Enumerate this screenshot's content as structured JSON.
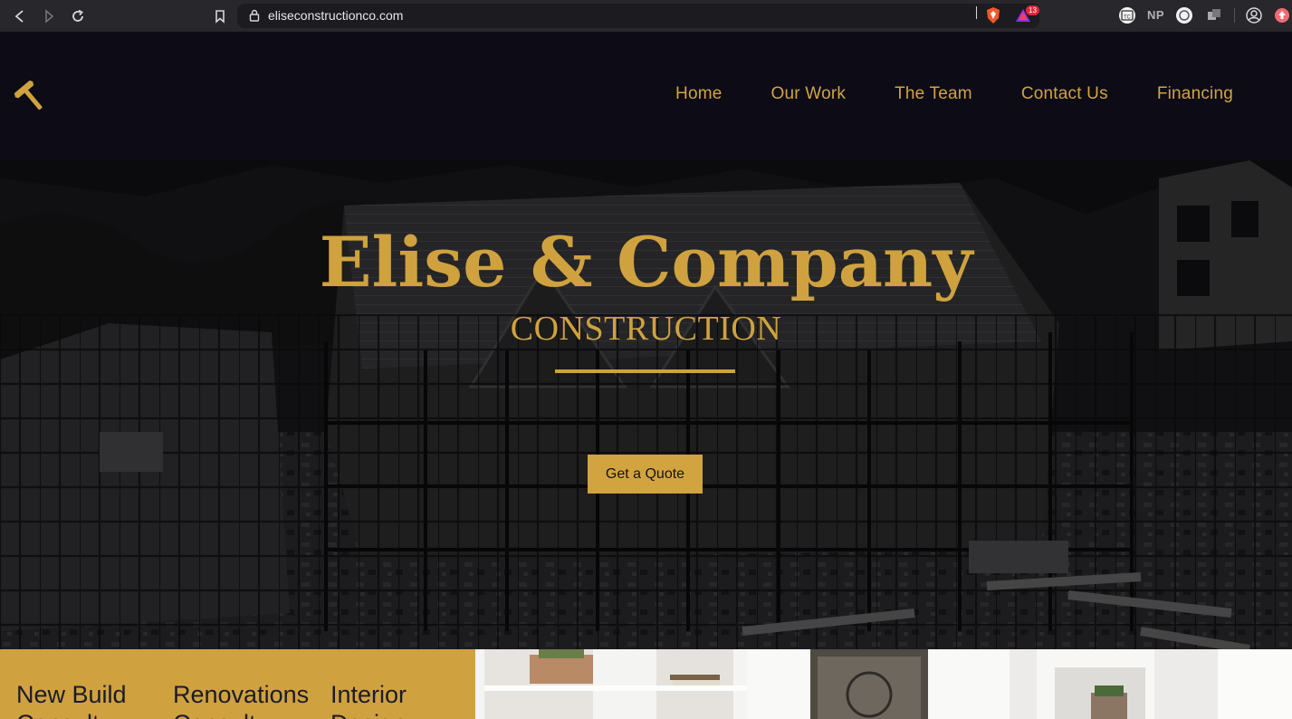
{
  "browser": {
    "url": "eliseconstructionco.com",
    "badge_count": "13",
    "np_label": "NP"
  },
  "header": {
    "logo_icon": "hammer-icon",
    "nav": [
      {
        "label": "Home"
      },
      {
        "label": "Our Work"
      },
      {
        "label": "The Team"
      },
      {
        "label": "Contact Us"
      },
      {
        "label": "Financing"
      }
    ]
  },
  "hero": {
    "title": "Elise & Company",
    "subtitle": "CONSTRUCTION",
    "cta_label": "Get a Quote"
  },
  "services": {
    "items": [
      {
        "line1": "New Build",
        "line2": "Consult"
      },
      {
        "line1": "Renovations",
        "line2": "Consult"
      },
      {
        "line1": "Interior",
        "line2": "Design"
      }
    ]
  },
  "colors": {
    "accent": "#cfa23f",
    "header_bg": "#0c0b16",
    "button_text": "#141414"
  }
}
